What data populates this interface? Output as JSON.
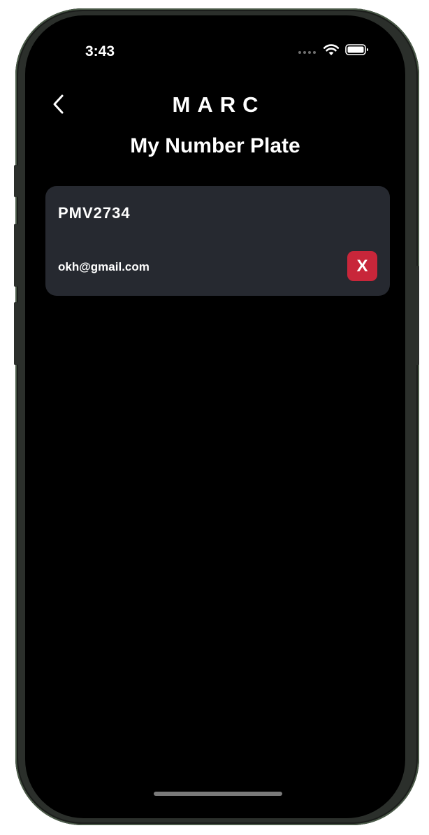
{
  "status_bar": {
    "time": "3:43",
    "icons": [
      "signal-dots-icon",
      "wifi-icon",
      "battery-icon"
    ]
  },
  "header": {
    "back_icon": "chevron-left-icon",
    "app_title": "MARC",
    "page_title": "My Number Plate"
  },
  "plates": [
    {
      "number": "PMV2734",
      "email": "okh@gmail.com",
      "remove_label": "X"
    }
  ],
  "colors": {
    "background": "#000000",
    "card": "#262930",
    "remove_button": "#c8263a",
    "text": "#ffffff"
  }
}
